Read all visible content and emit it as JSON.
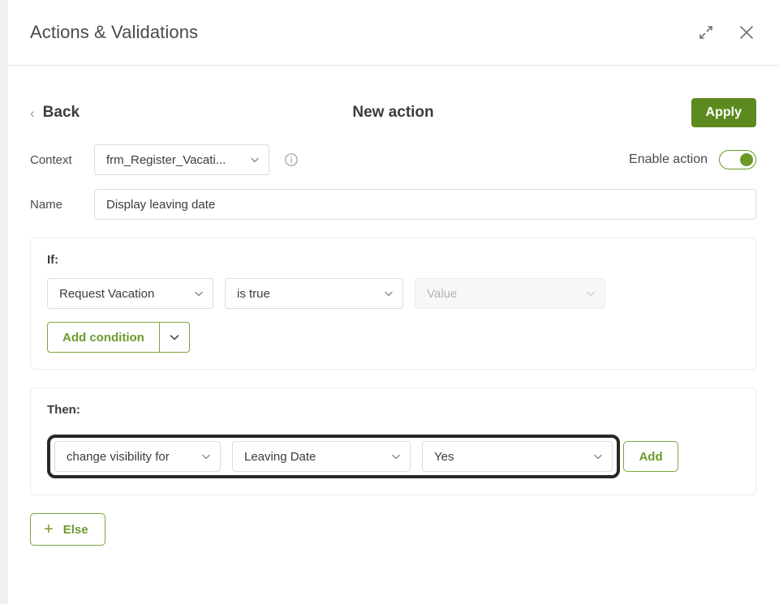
{
  "window": {
    "title": "Actions & Validations",
    "expand_icon": "expand-icon",
    "close_icon": "close-icon"
  },
  "toolbar": {
    "back_label": "Back",
    "back_icon": "chevron-left-icon",
    "title": "New action",
    "apply_label": "Apply"
  },
  "context": {
    "label": "Context",
    "value": "frm_Register_Vacati...",
    "info_icon": "info-icon",
    "chevron_icon": "chevron-down-icon"
  },
  "enable": {
    "label": "Enable action",
    "state": "on"
  },
  "name": {
    "label": "Name",
    "value": "Display leaving date",
    "placeholder": "Name"
  },
  "if_section": {
    "label": "If:",
    "condition": {
      "field": "Request Vacation",
      "operator": "is true",
      "value_placeholder": "Value",
      "value_disabled": true
    },
    "add_condition_label": "Add condition",
    "add_condition_arrow_icon": "chevron-down-icon"
  },
  "then_section": {
    "label": "Then:",
    "action": {
      "operation": "change visibility for",
      "target": "Leaving Date",
      "value": "Yes"
    },
    "add_label": "Add"
  },
  "else_button": {
    "label": "Else",
    "icon": "plus-icon"
  },
  "colors": {
    "accent_green": "#5c8a1f",
    "outline_green": "#7ba63e",
    "text_green": "#6d9a2e",
    "focus_ring": "#272727",
    "border_grey": "#dcdcdc"
  }
}
